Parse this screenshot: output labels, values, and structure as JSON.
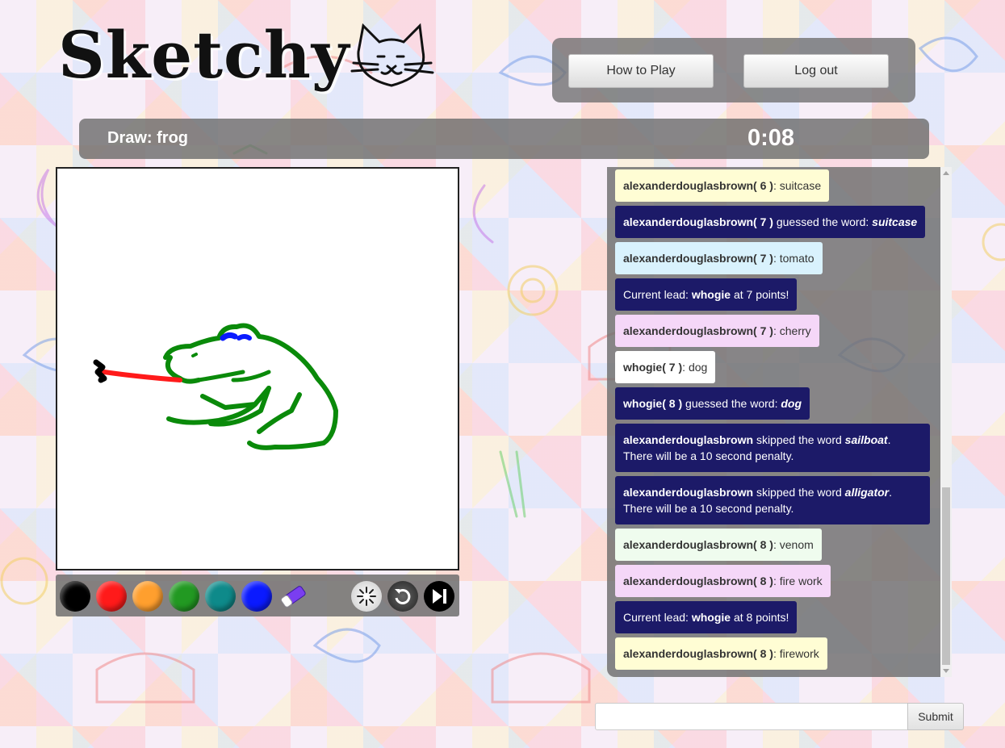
{
  "app": {
    "logo_text": "Sketchy"
  },
  "header": {
    "how_to_play_label": "How to Play",
    "logout_label": "Log out"
  },
  "round": {
    "draw_label": "Draw: frog",
    "timer": "0:08"
  },
  "palette": {
    "colors": [
      "#000000",
      "#ff1a1a",
      "#ff9f2e",
      "#229922",
      "#0e8a8a",
      "#0a1aff"
    ],
    "tools": [
      "eraser-icon",
      "clear-icon",
      "undo-icon",
      "skip-icon"
    ]
  },
  "chat": {
    "messages": [
      {
        "style": "yellow",
        "user": "alexanderdouglasbrown",
        "score": "6",
        "text": "suitcase"
      },
      {
        "style": "dark",
        "user": "alexanderdouglasbrown",
        "score": "7",
        "event": "guessed the word:",
        "word": "suitcase"
      },
      {
        "style": "blue",
        "user": "alexanderdouglasbrown",
        "score": "7",
        "text": "tomato"
      },
      {
        "style": "dark",
        "lead_prefix": "Current lead:",
        "lead_user": "whogie",
        "lead_suffix": "at 7 points!"
      },
      {
        "style": "pink",
        "user": "alexanderdouglasbrown",
        "score": "7",
        "text": "cherry"
      },
      {
        "style": "white",
        "user": "whogie",
        "score": "7",
        "text": "dog"
      },
      {
        "style": "dark",
        "user": "whogie",
        "score": "8",
        "event": "guessed the word:",
        "word": "dog"
      },
      {
        "style": "dark",
        "user": "alexanderdouglasbrown",
        "skip_prefix": "skipped the word",
        "word": "sailboat",
        "penalty": "There will be a 10 second penalty."
      },
      {
        "style": "dark",
        "user": "alexanderdouglasbrown",
        "skip_prefix": "skipped the word",
        "word": "alligator",
        "penalty": "There will be a 10 second penalty."
      },
      {
        "style": "mint",
        "user": "alexanderdouglasbrown",
        "score": "8",
        "text": "venom"
      },
      {
        "style": "pink",
        "user": "alexanderdouglasbrown",
        "score": "8",
        "text": "fire work"
      },
      {
        "style": "dark",
        "lead_prefix": "Current lead:",
        "lead_user": "whogie",
        "lead_suffix": "at 8 points!"
      },
      {
        "style": "yellow",
        "user": "alexanderdouglasbrown",
        "score": "8",
        "text": "firework"
      }
    ],
    "input_value": "",
    "submit_label": "Submit"
  }
}
